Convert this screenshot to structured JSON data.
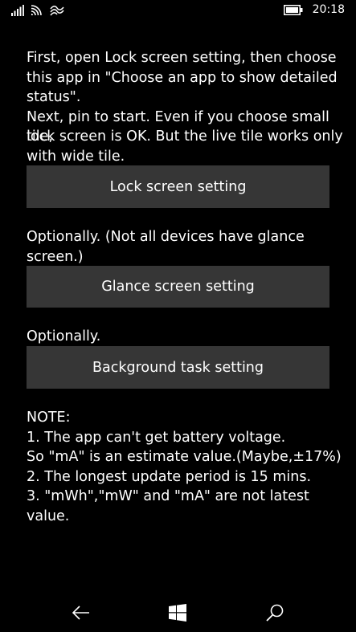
{
  "status_bar": {
    "time": "20:18",
    "icons": [
      "signal-icon",
      "wifi-icon",
      "wifi-calling-icon",
      "battery-icon"
    ]
  },
  "intro": {
    "line1": "First, open Lock screen setting, then choose",
    "line2": "this app in \"Choose an app to show detailed",
    "line3": "status\".",
    "line4": "Next, pin to start. Even if you choose small tile,",
    "line5": "lock screen is OK. But the live tile works only",
    "line6": "with wide tile."
  },
  "buttons": {
    "lock_screen": "Lock screen setting",
    "glance_screen": "Glance screen setting",
    "background_task": "Background task setting"
  },
  "glance_note": {
    "line1": "Optionally.  (Not all devices have glance",
    "line2": "screen.)"
  },
  "background_note": "Optionally.",
  "note": {
    "title": "NOTE:",
    "line1": "1. The app can't get battery voltage.",
    "line2": "So \"mA\" is an estimate value.(Maybe,±17%)",
    "line3": "2. The longest update period is 15 mins.",
    "line4": "3. \"mWh\",\"mW\" and \"mA\" are not latest value."
  },
  "nav": {
    "icons": [
      "back-arrow-icon",
      "windows-start-icon",
      "search-icon"
    ]
  }
}
